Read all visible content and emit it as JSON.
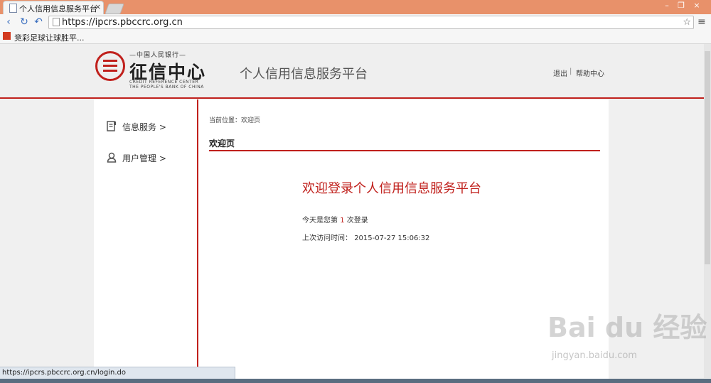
{
  "browser": {
    "tab_title": "个人信用信息服务平台",
    "tab_close": "×",
    "url": "https://ipcrs.pbccrc.org.cn",
    "bookmark": "竞彩足球让球胜平...",
    "status_url": "https://ipcrs.pbccrc.org.cn/login.do",
    "window_buttons": {
      "minimize": "–",
      "restore": "❐",
      "close": "×"
    },
    "nav_icons": {
      "back": "back-arrow-icon",
      "reload": "reload-icon",
      "undo": "undo-icon"
    }
  },
  "header": {
    "logo_top": "—中国人民银行—",
    "logo_main": "征信中心",
    "logo_en_line1": "CREDIT REFERENCE CENTER",
    "logo_en_line2": "THE PEOPLE'S BANK OF CHINA",
    "platform_title": "个人信用信息服务平台",
    "logout": "退出",
    "separator": "|",
    "help": "帮助中心"
  },
  "sidebar": {
    "items": [
      {
        "label": "信息服务 >",
        "icon": "document-icon"
      },
      {
        "label": "用户管理 >",
        "icon": "user-icon"
      }
    ]
  },
  "main": {
    "breadcrumb": "当前位置：欢迎页",
    "section_title": "欢迎页",
    "welcome": "欢迎登录个人信用信息服务平台",
    "login_prefix": "今天是您第",
    "login_count": "1",
    "login_suffix": "次登录",
    "last_visit_label": "上次访问时间：",
    "last_visit_value": "2015-07-27 15:06:32"
  },
  "watermark": {
    "text": "Bai du 经验",
    "url": "jingyan.baidu.com"
  },
  "colors": {
    "accent": "#c0201c",
    "titlebar": "#e8916a"
  }
}
